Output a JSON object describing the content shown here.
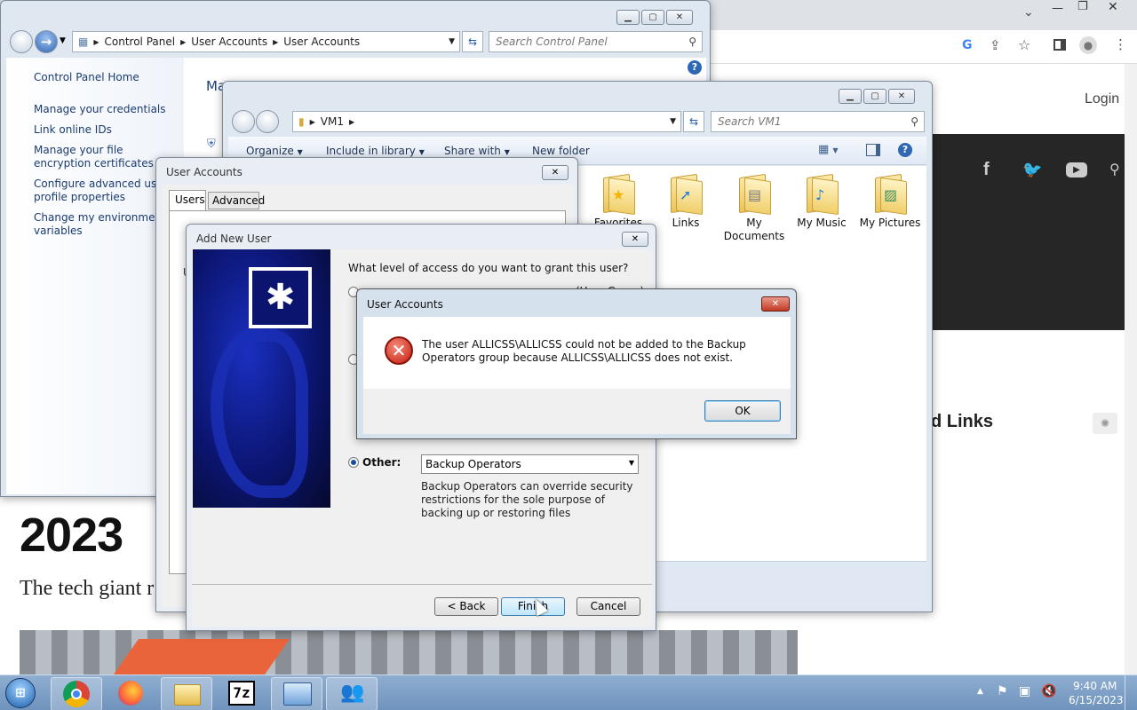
{
  "browser": {
    "login_label": "Login",
    "section_heading": "d Links",
    "article_year": "2023",
    "article_lead": "The tech giant r",
    "toolbar_icons": [
      "google-icon",
      "share-icon",
      "star-icon",
      "sidebar-icon",
      "profile-icon",
      "menu-icon"
    ],
    "social_icons": [
      "facebook-icon",
      "twitter-icon",
      "youtube-icon",
      "search-icon"
    ]
  },
  "control_panel": {
    "breadcrumb": [
      "Control Panel",
      "User Accounts",
      "User Accounts"
    ],
    "search_placeholder": "Search Control Panel",
    "home_link": "Control Panel Home",
    "links": [
      "Manage your credentials",
      "Link online IDs",
      "Manage your file encryption certificates",
      "Configure advanced user profile properties",
      "Change my environment variables"
    ],
    "main_title_partial": "Ma"
  },
  "explorer": {
    "breadcrumb": [
      "VM1"
    ],
    "search_placeholder": "Search VM1",
    "toolbar": {
      "organize": "Organize",
      "include": "Include in library",
      "share": "Share with",
      "new_folder": "New folder"
    },
    "folders": [
      {
        "name": "Favorites",
        "icon": "favorites-folder-icon"
      },
      {
        "name": "Links",
        "icon": "links-folder-icon"
      },
      {
        "name": "My Documents",
        "icon": "documents-folder-icon"
      },
      {
        "name": "My Music",
        "icon": "music-folder-icon"
      },
      {
        "name": "My Pictures",
        "icon": "pictures-folder-icon"
      }
    ]
  },
  "user_accounts_dialog": {
    "title": "User Accounts",
    "tabs": [
      "Users",
      "Advanced"
    ],
    "partial_label": "U"
  },
  "add_user_wizard": {
    "title": "Add New User",
    "question": "What level of access do you want to grant this user?",
    "partial_option": "(User Group)",
    "other_label": "Other:",
    "group_selected": "Backup Operators",
    "group_description": "Backup Operators can override security restrictions for the sole purpose of backing up or restoring files",
    "back_button": "< Back",
    "finish_button": "Finish",
    "cancel_button": "Cancel"
  },
  "error_dialog": {
    "title": "User Accounts",
    "message": "The user ALLICSS\\ALLICSS could not be added to the Backup Operators group because ALLICSS\\ALLICSS does not exist.",
    "ok_button": "OK"
  },
  "taskbar": {
    "apps": [
      "start-orb-icon",
      "chrome-icon",
      "firefox-icon",
      "file-explorer-icon",
      "7zip-icon",
      "control-panel-icon",
      "user-accounts-icon"
    ],
    "sevenzip_label": "7z",
    "time": "9:40 AM",
    "date": "6/15/2023"
  }
}
